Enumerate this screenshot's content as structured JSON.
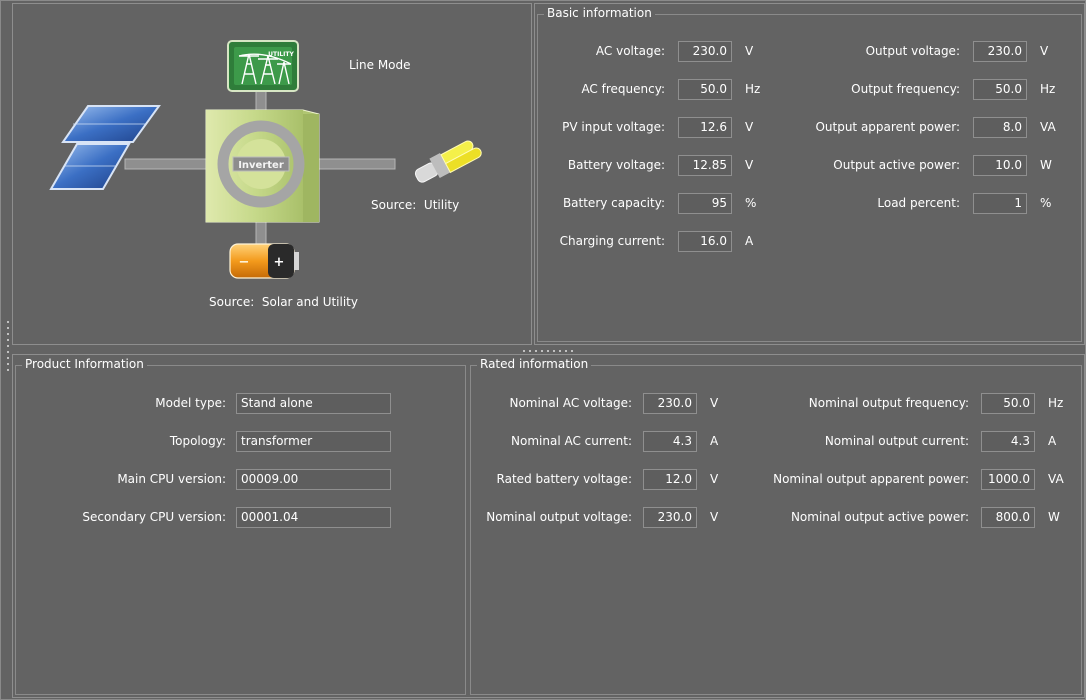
{
  "diagram": {
    "mode": "Line Mode",
    "inverter_label": "Inverter",
    "utility_badge": "UTILITY",
    "source_right_prefix": "Source:",
    "source_right_value": "Utility",
    "source_bottom_prefix": "Source:",
    "source_bottom_value": "Solar and Utility"
  },
  "basic": {
    "title": "Basic information",
    "left": [
      {
        "label": "AC voltage:",
        "value": "230.0",
        "unit": "V"
      },
      {
        "label": "AC frequency:",
        "value": "50.0",
        "unit": "Hz"
      },
      {
        "label": "PV input voltage:",
        "value": "12.6",
        "unit": "V"
      },
      {
        "label": "Battery voltage:",
        "value": "12.85",
        "unit": "V"
      },
      {
        "label": "Battery capacity:",
        "value": "95",
        "unit": "%"
      },
      {
        "label": "Charging current:",
        "value": "16.0",
        "unit": "A"
      }
    ],
    "right": [
      {
        "label": "Output voltage:",
        "value": "230.0",
        "unit": "V"
      },
      {
        "label": "Output frequency:",
        "value": "50.0",
        "unit": "Hz"
      },
      {
        "label": "Output apparent power:",
        "value": "8.0",
        "unit": "VA"
      },
      {
        "label": "Output active power:",
        "value": "10.0",
        "unit": "W"
      },
      {
        "label": "Load percent:",
        "value": "1",
        "unit": "%"
      }
    ]
  },
  "product": {
    "title": "Product Information",
    "rows": [
      {
        "label": "Model type:",
        "value": "Stand alone"
      },
      {
        "label": "Topology:",
        "value": "transformer"
      },
      {
        "label": "Main CPU version:",
        "value": "00009.00"
      },
      {
        "label": "Secondary CPU version:",
        "value": "00001.04"
      }
    ]
  },
  "rated": {
    "title": "Rated information",
    "left": [
      {
        "label": "Nominal AC voltage:",
        "value": "230.0",
        "unit": "V"
      },
      {
        "label": "Nominal AC current:",
        "value": "4.3",
        "unit": "A"
      },
      {
        "label": "Rated battery voltage:",
        "value": "12.0",
        "unit": "V"
      },
      {
        "label": "Nominal output voltage:",
        "value": "230.0",
        "unit": "V"
      }
    ],
    "right": [
      {
        "label": "Nominal output frequency:",
        "value": "50.0",
        "unit": "Hz"
      },
      {
        "label": "Nominal output current:",
        "value": "4.3",
        "unit": "A"
      },
      {
        "label": "Nominal output apparent power:",
        "value": "1000.0",
        "unit": "VA"
      },
      {
        "label": "Nominal output active power:",
        "value": "800.0",
        "unit": "W"
      }
    ]
  },
  "icons": {
    "solar": "solar-panel-icon",
    "utility": "utility-tower-icon",
    "inverter": "inverter-icon",
    "load": "light-bulb-icon",
    "battery": "battery-icon"
  },
  "colors": {
    "background": "#636363",
    "border": "#8e8e8e",
    "text": "#ffffff",
    "inverter_green": "#c8d98a",
    "utility_green": "#2f7d3a",
    "battery_orange": "#f39a1c",
    "bulb_yellow": "#f4f04a",
    "solar_blue": "#3b6fc4"
  }
}
